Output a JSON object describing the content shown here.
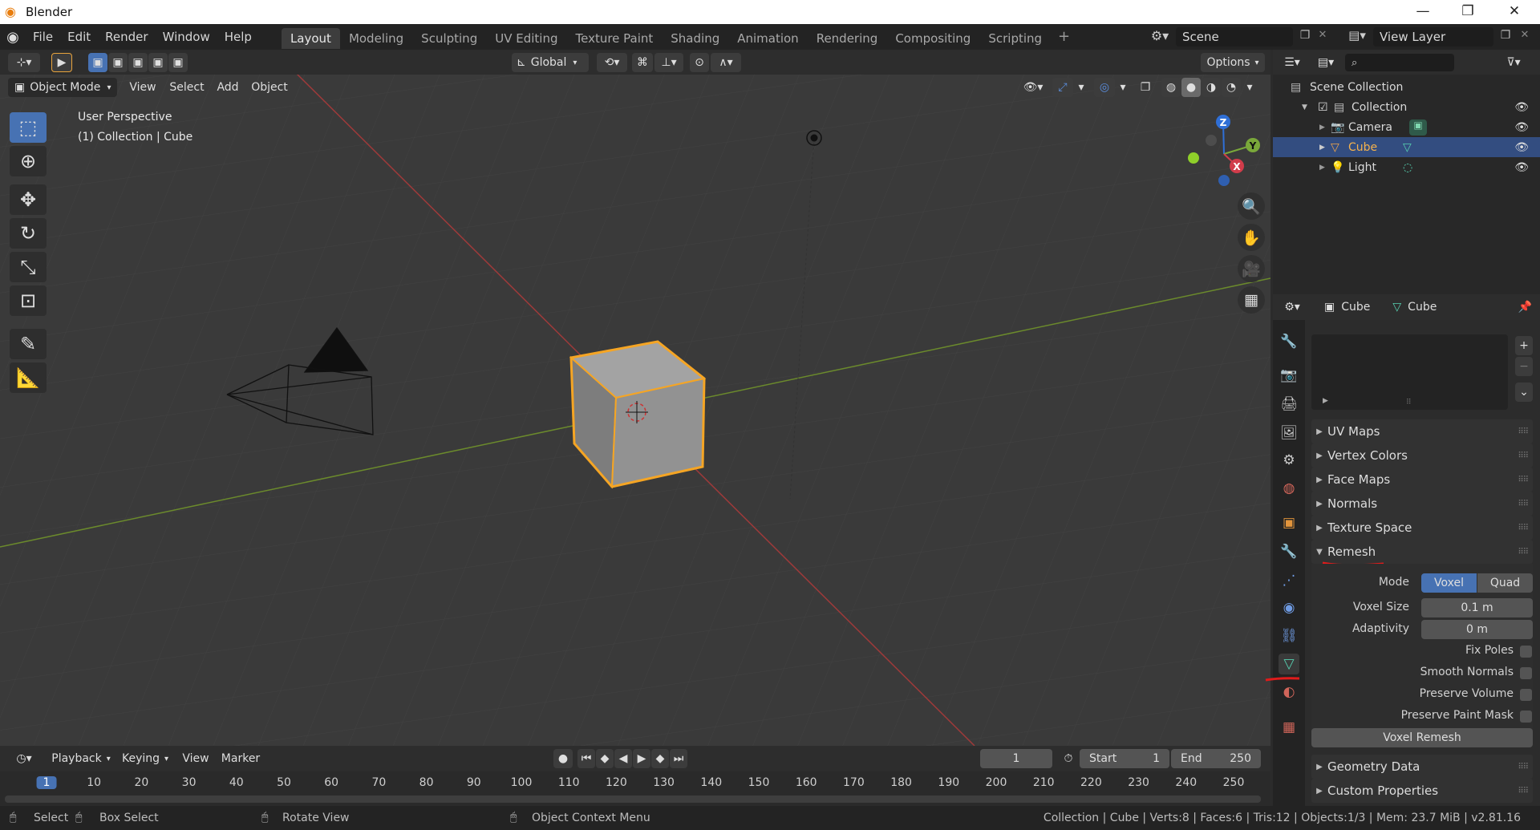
{
  "window": {
    "title": "Blender",
    "minimize": "—",
    "maximize": "❐",
    "close": "✕"
  },
  "menu": [
    "File",
    "Edit",
    "Render",
    "Window",
    "Help"
  ],
  "workspaces": [
    "Layout",
    "Modeling",
    "Sculpting",
    "UV Editing",
    "Texture Paint",
    "Shading",
    "Animation",
    "Rendering",
    "Compositing",
    "Scripting"
  ],
  "active_workspace": "Layout",
  "scene": {
    "name": "Scene",
    "view_layer": "View Layer"
  },
  "viewport": {
    "mode": "Object Mode",
    "menus": [
      "View",
      "Select",
      "Add",
      "Object"
    ],
    "transform_orientation": "Global",
    "options_label": "Options",
    "info_line1": "User Perspective",
    "info_line2": "(1) Collection | Cube",
    "gizmo_axes": [
      "Z",
      "Y",
      "X"
    ]
  },
  "outliner": {
    "root": "Scene Collection",
    "items": [
      {
        "name": "Collection",
        "depth": 1
      },
      {
        "name": "Camera",
        "depth": 2
      },
      {
        "name": "Cube",
        "depth": 2,
        "selected": true
      },
      {
        "name": "Light",
        "depth": 2
      }
    ]
  },
  "properties": {
    "object_name": "Cube",
    "data_name": "Cube",
    "collapsed_panels": [
      "UV Maps",
      "Vertex Colors",
      "Face Maps",
      "Normals",
      "Texture Space"
    ],
    "remesh": {
      "title": "Remesh",
      "mode_label": "Mode",
      "modes": [
        "Voxel",
        "Quad"
      ],
      "active_mode": "Voxel",
      "voxel_size_label": "Voxel Size",
      "voxel_size": "0.1 m",
      "adaptivity_label": "Adaptivity",
      "adaptivity": "0 m",
      "options": [
        "Fix Poles",
        "Smooth Normals",
        "Preserve Volume",
        "Preserve Paint Mask"
      ],
      "button": "Voxel Remesh"
    },
    "bottom_panels": [
      "Geometry Data",
      "Custom Properties"
    ]
  },
  "timeline": {
    "menus": [
      "Playback",
      "Keying",
      "View",
      "Marker"
    ],
    "current_frame": "1",
    "start_label": "Start",
    "start": "1",
    "end_label": "End",
    "end": "250",
    "ticks": [
      "1",
      "10",
      "20",
      "30",
      "40",
      "50",
      "60",
      "70",
      "80",
      "90",
      "100",
      "110",
      "120",
      "130",
      "140",
      "150",
      "160",
      "170",
      "180",
      "190",
      "200",
      "210",
      "220",
      "230",
      "240",
      "250"
    ]
  },
  "status": {
    "select": "Select",
    "box_select": "Box Select",
    "rotate_view": "Rotate View",
    "context_menu": "Object Context Menu",
    "stats": "Collection | Cube | Verts:8 | Faces:6 | Tris:12 | Objects:1/3 | Mem: 23.7 MiB | v2.81.16"
  },
  "colors": {
    "accent": "#4772b3",
    "selection_outline": "#f5a524",
    "annotation": "#e01b1b"
  }
}
